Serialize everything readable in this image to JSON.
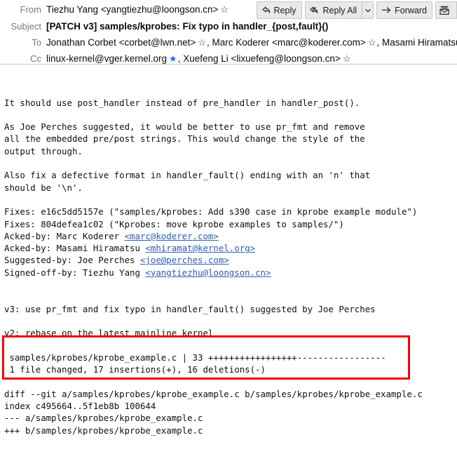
{
  "header": {
    "from_label": "From",
    "from_value": "Tiezhu Yang <yangtiezhu@loongson.cn>",
    "subject_label": "Subject",
    "subject_value": "[PATCH v3] samples/kprobes: Fix typo in handler_{post,fault}()",
    "to_label": "To",
    "to_part1": "Jonathan Corbet <corbet@lwn.net>",
    "to_part2": ", Marc Koderer <marc@koderer.com>",
    "to_part3": ", Masami Hiramatsu <mhiramat@k",
    "cc_label": "Cc",
    "cc_part1": "linux-kernel@vger.kernel.org",
    "cc_part2": ", Xuefeng Li <lixuefeng@loongson.cn>",
    "star_glyph": "☆",
    "star_filled_glyph": "★"
  },
  "toolbar": {
    "reply_label": "Reply",
    "reply_all_label": "Reply All",
    "reply_all_caret": "⌵",
    "forward_label": "Forward",
    "archive_label": ""
  },
  "body": {
    "lines": [
      {
        "text": "It should use post_handler instead of pre_handler in handler_post()."
      },
      {
        "text": ""
      },
      {
        "text": "As Joe Perches suggested, it would be better to use pr_fmt and remove"
      },
      {
        "text": "all the embedded pre/post strings. This would change the style of the"
      },
      {
        "text": "output through."
      },
      {
        "text": ""
      },
      {
        "text": "Also fix a defective format in handler_fault() ending with an 'n' that"
      },
      {
        "text": "should be '\\n'."
      },
      {
        "text": ""
      },
      {
        "text": "Fixes: e16c5dd5157e (\"samples/kprobes: Add s390 case in kprobe example module\")"
      },
      {
        "text": "Fixes: 804defea1c02 (\"Kprobes: move kprobe examples to samples/\")"
      },
      {
        "text": "Acked-by: Marc Koderer ",
        "link": "<marc@koderer.com>"
      },
      {
        "text": "Acked-by: Masami Hiramatsu ",
        "link": "<mhiramat@kernel.org>"
      },
      {
        "text": "Suggested-by: Joe Perches ",
        "link": "<joe@perches.com>"
      },
      {
        "text": "Signed-off-by: Tiezhu Yang ",
        "link": "<yangtiezhu@loongson.cn>"
      },
      {
        "text": ""
      },
      {
        "text": ""
      },
      {
        "text": "v3: use pr_fmt and fix typo in handler_fault() suggested by Joe Perches"
      },
      {
        "text": ""
      },
      {
        "text": "v2: rebase on the latest mainline kernel"
      },
      {
        "text": ""
      },
      {
        "text": " samples/kprobes/kprobe_example.c | 33 +++++++++++++++++-----------------"
      },
      {
        "text": " 1 file changed, 17 insertions(+), 16 deletions(-)"
      },
      {
        "text": ""
      },
      {
        "text": "diff --git a/samples/kprobes/kprobe_example.c b/samples/kprobes/kprobe_example.c"
      },
      {
        "text": "index c495664..5f1eb8b 100644"
      },
      {
        "text": "--- a/samples/kprobes/kprobe_example.c"
      },
      {
        "text": "+++ b/samples/kprobes/kprobe_example.c"
      }
    ]
  },
  "annotation": {
    "color": "#f40000",
    "highlighted_lines": [
      "v3: use pr_fmt and fix typo in handler_fault() suggested by Joe Perches",
      "v2: rebase on the latest mainline kernel"
    ]
  }
}
